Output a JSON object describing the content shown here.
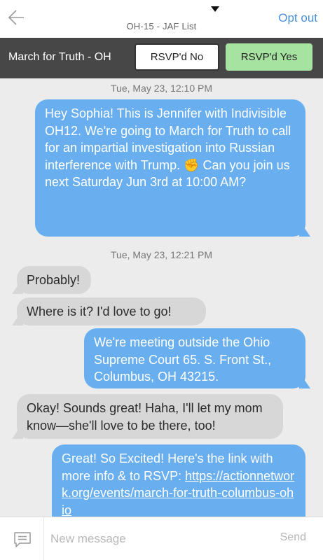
{
  "header": {
    "list_name": "OH-15 - JAF List",
    "opt_out_label": "Opt out",
    "back_icon": "back-arrow-icon",
    "dropdown_icon": "caret-down-icon"
  },
  "campaign_bar": {
    "title": "March for Truth - OH",
    "rsvp_no_label": "RSVP'd No",
    "rsvp_yes_label": "RSVP'd Yes",
    "rsvp_yes_color": "#a6e2a0"
  },
  "conversation": {
    "timestamp_1": "Tue, May 23, 12:10 PM",
    "message_1": {
      "direction": "outgoing",
      "text": "Hey Sophia! This is Jennifer with Indivisible OH12. We're going to March for Truth to call for an impartial investigation into Russian interference with Trump.",
      "emoji": "✊",
      "text_after_emoji": "Can you join us next Saturday Jun 3rd at 10:00 AM?"
    },
    "timestamp_2": "Tue, May 23, 12:21 PM",
    "message_2": {
      "direction": "incoming",
      "text": "Probably!"
    },
    "message_3": {
      "direction": "incoming",
      "text": "Where is it? I'd love to go!"
    },
    "message_4": {
      "direction": "outgoing",
      "text": "We're meeting outside the Ohio Supreme Court 65. S. Front St., Columbus, OH 43215."
    },
    "message_5": {
      "direction": "incoming",
      "text": "Okay! Sounds great! Haha, I'll let my mom know—she'll love to be there, too!"
    },
    "message_6": {
      "direction": "outgoing",
      "text": "Great! So Excited! Here's the link with more info & to RSVP:",
      "link": "https://actionnetwork.org/events/march-for-truth-columbus-ohio"
    },
    "outgoing_color": "#69aff0",
    "incoming_color": "#d7d7d7"
  },
  "composer": {
    "placeholder": "New message",
    "send_label": "Send",
    "icon": "chat-bubble-icon"
  }
}
